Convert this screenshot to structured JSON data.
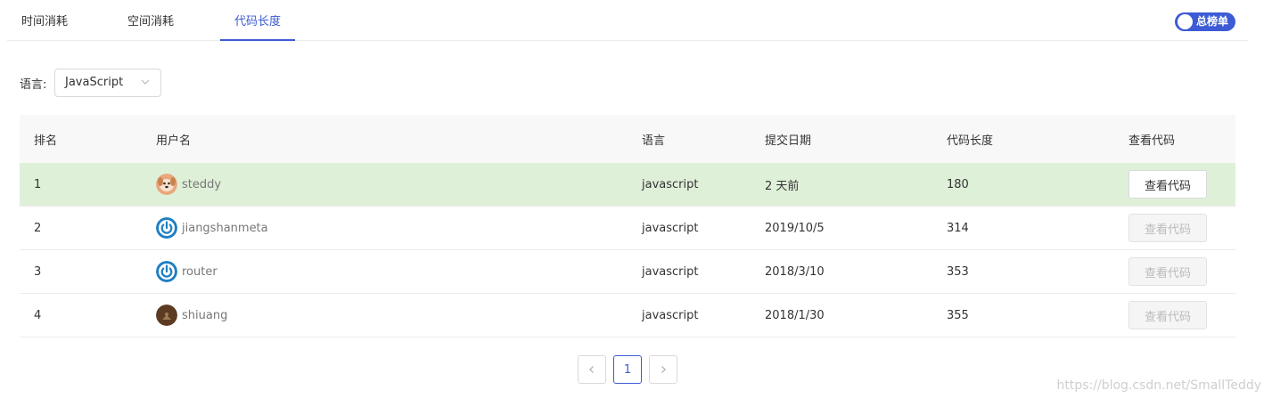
{
  "tabs": [
    {
      "label": "时间消耗",
      "active": false
    },
    {
      "label": "空间消耗",
      "active": false
    },
    {
      "label": "代码长度",
      "active": true
    }
  ],
  "toggle": {
    "label": "总榜单",
    "on": true
  },
  "filter": {
    "label": "语言:",
    "selected": "JavaScript"
  },
  "table": {
    "headers": {
      "rank": "排名",
      "user": "用户名",
      "lang": "语言",
      "date": "提交日期",
      "length": "代码长度",
      "view": "查看代码"
    },
    "rows": [
      {
        "rank": "1",
        "user": "steddy",
        "lang": "javascript",
        "date": "2 天前",
        "length": "180",
        "view": "查看代码",
        "enabled": true,
        "highlight": true,
        "avatar": "dog-avatar"
      },
      {
        "rank": "2",
        "user": "jiangshanmeta",
        "lang": "javascript",
        "date": "2019/10/5",
        "length": "314",
        "view": "查看代码",
        "enabled": false,
        "highlight": false,
        "avatar": "power-avatar"
      },
      {
        "rank": "3",
        "user": "router",
        "lang": "javascript",
        "date": "2018/3/10",
        "length": "353",
        "view": "查看代码",
        "enabled": false,
        "highlight": false,
        "avatar": "power-avatar"
      },
      {
        "rank": "4",
        "user": "shiuang",
        "lang": "javascript",
        "date": "2018/1/30",
        "length": "355",
        "view": "查看代码",
        "enabled": false,
        "highlight": false,
        "avatar": "brown-avatar"
      }
    ]
  },
  "pagination": {
    "current": "1",
    "prev_icon": "chevron-left-icon",
    "next_icon": "chevron-right-icon"
  },
  "watermark": "https://blog.csdn.net/SmallTeddy",
  "colors": {
    "accent": "#3d5bd4",
    "highlight_row": "#dff0d8",
    "avatar_blue": "#1d7fc4"
  }
}
